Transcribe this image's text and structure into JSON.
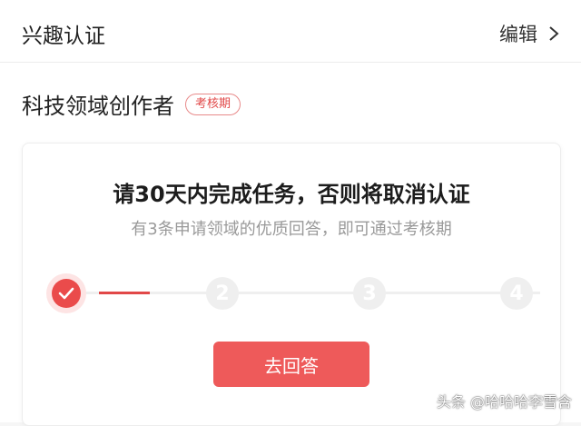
{
  "header": {
    "title": "兴趣认证",
    "edit_label": "编辑"
  },
  "certification": {
    "name": "科技领域创作者",
    "status": "考核期"
  },
  "task_card": {
    "title": "请30天内完成任务，否则将取消认证",
    "subtitle": "有3条申请领域的优质回答，即可通过考核期",
    "progress": {
      "completed": 1,
      "total": 4,
      "steps": [
        "1",
        "2",
        "3",
        "4"
      ]
    },
    "action_label": "去回答"
  },
  "watermark": "头条 @哈哈哈李雪含",
  "colors": {
    "accent": "#e14848",
    "button": "#ee5a5a",
    "inactive": "#efefef"
  },
  "icons": {
    "edit": "chevron-right-icon",
    "step_done": "check-icon"
  }
}
